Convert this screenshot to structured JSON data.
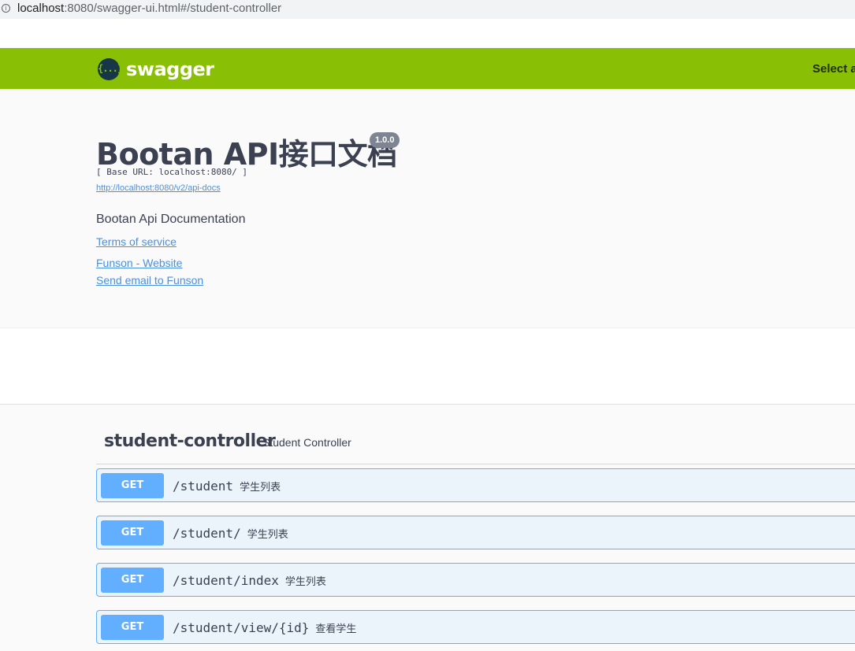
{
  "browser": {
    "info_icon": "i",
    "url_host": "localhost",
    "url_rest": ":8080/swagger-ui.html#/student-controller"
  },
  "topbar": {
    "logo_mark": "{...}",
    "logo_text": "swagger",
    "select_label": "Select a",
    "color": "#89bf04"
  },
  "info": {
    "title": "Bootan API接口文档",
    "version": "1.0.0",
    "base_url": "[ Base URL: localhost:8080/ ]",
    "api_docs_link": "http://localhost:8080/v2/api-docs",
    "description": "Bootan Api Documentation",
    "terms": "Terms of service",
    "website": "Funson - Website",
    "email": "Send email to Funson"
  },
  "tag": {
    "name": "student-controller",
    "description": "Student Controller"
  },
  "operations": [
    {
      "method": "GET",
      "path": "/student",
      "summary": "学生列表"
    },
    {
      "method": "GET",
      "path": "/student/",
      "summary": "学生列表"
    },
    {
      "method": "GET",
      "path": "/student/index",
      "summary": "学生列表"
    },
    {
      "method": "GET",
      "path": "/student/view/{id}",
      "summary": "查看学生"
    }
  ]
}
